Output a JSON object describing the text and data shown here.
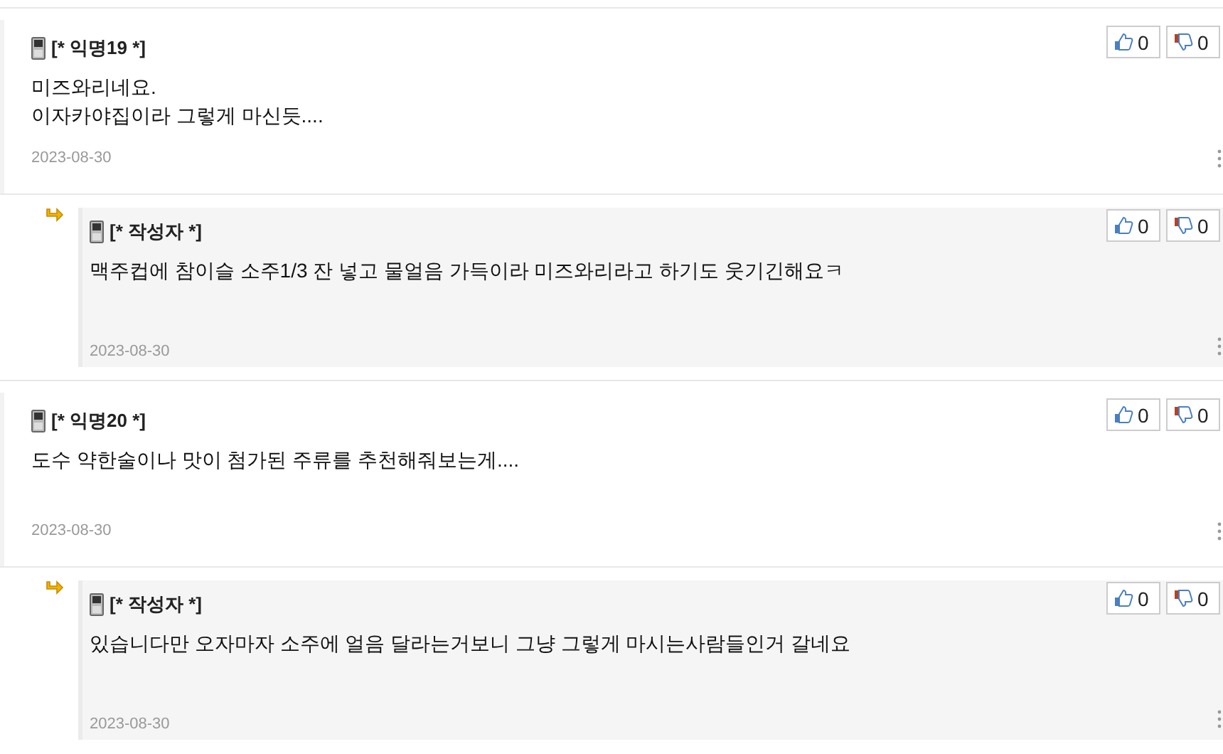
{
  "comments": [
    {
      "kind": "comment",
      "author": "[* 익명19 *]",
      "lines": [
        "미즈와리네요.",
        "이자카야집이라 그렇게 마신듯...."
      ],
      "date": "2023-08-30",
      "likes": "0",
      "dislikes": "0"
    },
    {
      "kind": "reply",
      "author": "[* 작성자 *]",
      "lines": [
        "맥주컵에 참이슬 소주1/3 잔 넣고 물얼음 가득이라 미즈와리라고 하기도 웃기긴해요ㅋ"
      ],
      "date": "2023-08-30",
      "likes": "0",
      "dislikes": "0"
    },
    {
      "kind": "comment",
      "author": "[* 익명20 *]",
      "lines": [
        "도수 약한술이나 맛이 첨가된 주류를  추천해줘보는게...."
      ],
      "date": "2023-08-30",
      "likes": "0",
      "dislikes": "0"
    },
    {
      "kind": "reply",
      "author": "[* 작성자 *]",
      "lines": [
        "있습니다만 오자마자 소주에 얼음 달라는거보니 그냥 그렇게 마시는사람들인거 갈네요"
      ],
      "date": "2023-08-30",
      "likes": "0",
      "dislikes": "0"
    }
  ]
}
